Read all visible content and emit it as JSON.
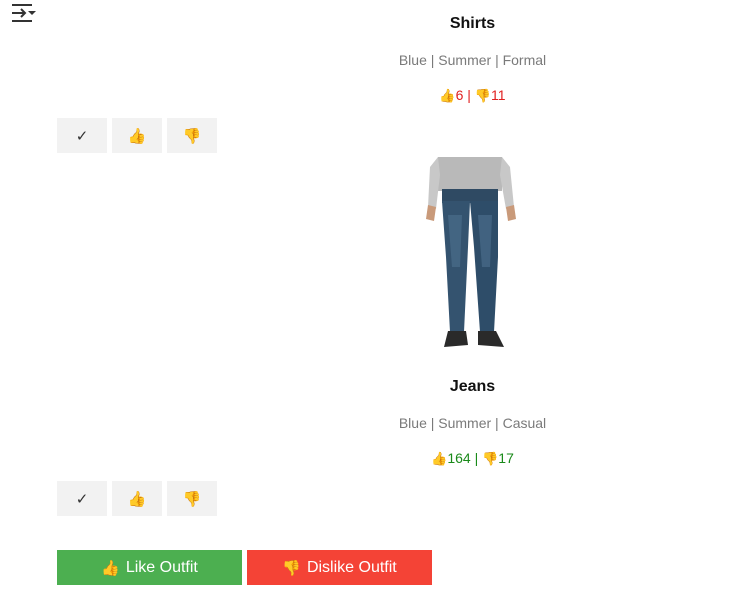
{
  "toolbar": {
    "menu_icon": "filter-list-icon"
  },
  "items": [
    {
      "title": "Shirts",
      "tags": "Blue | Summer | Formal",
      "likes": "6",
      "separator": "|",
      "dislikes": "11",
      "votes_color": "#e02020",
      "buttons": {
        "check": "✓",
        "like": "👍",
        "dislike": "👎"
      }
    },
    {
      "title": "Jeans",
      "tags": "Blue | Summer | Casual",
      "likes": "164",
      "separator": "|",
      "dislikes": "17",
      "votes_color": "#1a8a1a",
      "image": "jeans-product-photo",
      "buttons": {
        "check": "✓",
        "like": "👍",
        "dislike": "👎"
      }
    }
  ],
  "actions": {
    "like_outfit_label": "Like Outfit",
    "dislike_outfit_label": "Dislike Outfit",
    "like_color": "#4caf50",
    "dislike_color": "#f44336"
  },
  "glyphs": {
    "thumbs_up": "👍",
    "thumbs_down": "👎"
  }
}
